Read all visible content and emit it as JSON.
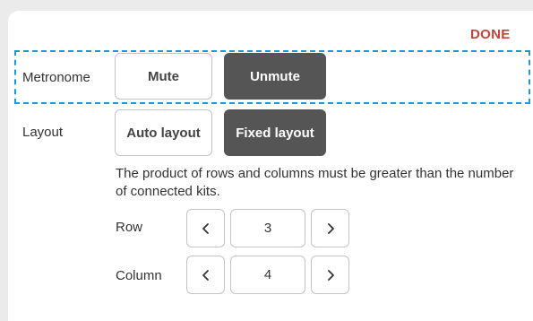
{
  "header": {
    "done_label": "DONE"
  },
  "metronome": {
    "label": "Metronome",
    "options": [
      "Mute",
      "Unmute"
    ],
    "selected": "Unmute"
  },
  "layout": {
    "label": "Layout",
    "options": [
      "Auto layout",
      "Fixed layout"
    ],
    "selected": "Fixed layout",
    "note": "The product of rows and columns must be greater than the number of connected kits."
  },
  "row": {
    "label": "Row",
    "value": "3"
  },
  "column": {
    "label": "Column",
    "value": "4"
  },
  "colors": {
    "accent": "#c9423a",
    "selected": "#555555",
    "highlight": "#1a9ad6"
  },
  "icons": {
    "decrement": "chevron-left-icon",
    "increment": "chevron-right-icon"
  }
}
